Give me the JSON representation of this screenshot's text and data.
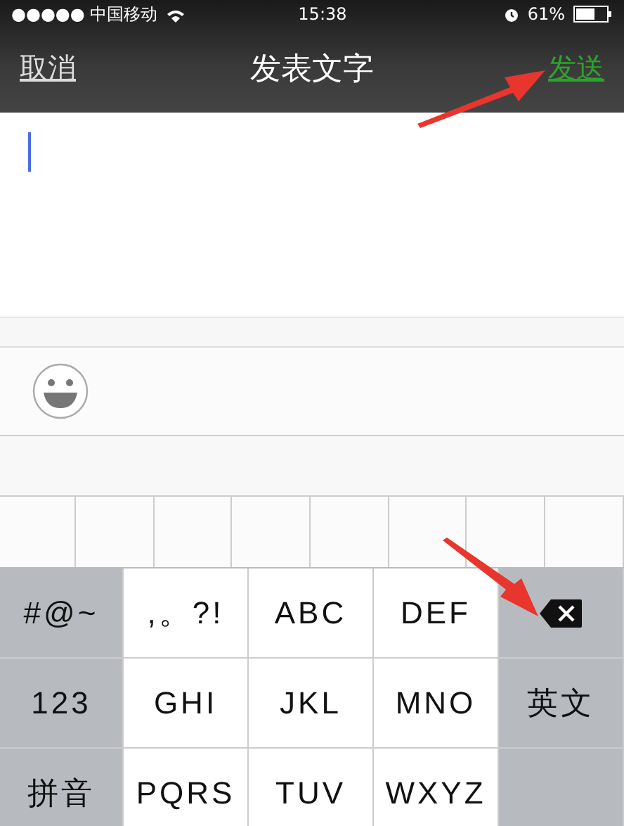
{
  "status_bar": {
    "signal": "●●●●●",
    "carrier": "中国移动",
    "time": "15:38",
    "battery": "61%"
  },
  "nav": {
    "cancel": "取消",
    "title": "发表文字",
    "send": "发送"
  },
  "keyboard": {
    "rows": [
      [
        {
          "kind": "function",
          "label": "#@~"
        },
        {
          "kind": "letter",
          "label": ",。?!"
        },
        {
          "kind": "letter",
          "label": "ABC"
        },
        {
          "kind": "letter",
          "label": "DEF"
        },
        {
          "kind": "delete"
        }
      ],
      [
        {
          "kind": "function",
          "label": "123"
        },
        {
          "kind": "letter",
          "label": "GHI"
        },
        {
          "kind": "letter",
          "label": "JKL"
        },
        {
          "kind": "letter",
          "label": "MNO"
        },
        {
          "kind": "function",
          "label": "英文"
        }
      ],
      [
        {
          "kind": "function",
          "label": "拼音"
        },
        {
          "kind": "letter",
          "label": "PQRS"
        },
        {
          "kind": "letter",
          "label": "TUV"
        },
        {
          "kind": "letter",
          "label": "WXYZ"
        },
        {
          "kind": "blank"
        }
      ]
    ]
  }
}
